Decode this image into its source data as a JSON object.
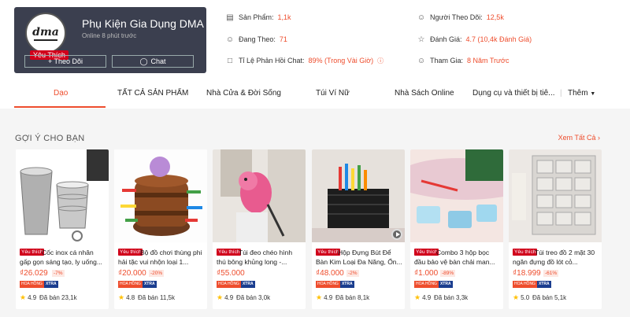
{
  "shop": {
    "name": "Phụ Kiện Gia Dụng DMA",
    "online": "Online 8 phút trước",
    "badge": "Yêu Thích",
    "logo_text": "dma",
    "follow_button": "+ Theo Dõi",
    "chat_button": "Chat"
  },
  "stats": {
    "products_label": "Sản Phẩm:",
    "products_value": "1,1k",
    "following_label": "Đang Theo:",
    "following_value": "71",
    "response_label": "Tỉ Lệ Phản Hồi Chat:",
    "response_value": "89% (Trong Vài Giờ)",
    "followers_label": "Người Theo Dõi:",
    "followers_value": "12,5k",
    "rating_label": "Đánh Giá:",
    "rating_value": "4.7 (10,4k Đánh Giá)",
    "joined_label": "Tham Gia:",
    "joined_value": "8 Năm Trước"
  },
  "tabs": [
    "Dạo",
    "TẤT CẢ SẢN PHẨM",
    "Nhà Cửa & Đời Sống",
    "Túi Ví Nữ",
    "Nhà Sách Online",
    "Dụng cụ và thiết bị tiê...",
    "Thêm"
  ],
  "section": {
    "title": "GỢI Ý CHO BẠN",
    "see_all": "Xem Tất Cả"
  },
  "products": [
    {
      "badge": "Yêu thích",
      "title": "Cốc inox cá nhân gấp gọn sáng tạo, ly uống...",
      "price": "₫26.029",
      "discount": "-7%",
      "tag_a": "HOA HỒNG",
      "tag_b": "XTRA",
      "rating": "4.9",
      "sold": "Đã bán 23,1k"
    },
    {
      "badge": "Yêu thích",
      "title": "Bộ đồ chơi thùng phi hải tặc vui nhộn loại 1...",
      "price": "₫20.000",
      "discount": "-20%",
      "tag_a": "HOA HỒNG",
      "tag_b": "XTRA",
      "rating": "4.8",
      "sold": "Đã bán 11,5k"
    },
    {
      "badge": "Yêu thích",
      "title": "Túi đeo chéo hình thú bông khủng long -...",
      "price": "₫55.000",
      "discount": "",
      "tag_a": "HOA HỒNG",
      "tag_b": "XTRA",
      "rating": "4.9",
      "sold": "Đã bán 3,0k"
    },
    {
      "badge": "Yêu thích",
      "title": "Hộp Đựng Bút Để Bàn Kim Loại Đa Năng, Ổn...",
      "price": "₫48.000",
      "discount": "-2%",
      "tag_a": "HOA HỒNG",
      "tag_b": "XTRA",
      "rating": "4.9",
      "sold": "Đã bán 8,1k"
    },
    {
      "badge": "Yêu thích",
      "title": "Combo 3 hộp bọc đầu bảo vệ bàn chải man...",
      "price": "₫1.000",
      "discount": "-89%",
      "tag_a": "HOA HỒNG",
      "tag_b": "XTRA",
      "rating": "4.9",
      "sold": "Đã bán 3,3k"
    },
    {
      "badge": "Yêu thích",
      "title": "Túi treo đồ 2 mặt 30 ngăn đựng đồ lót cỏ...",
      "price": "₫18.999",
      "discount": "-61%",
      "tag_a": "HOA HỒNG",
      "tag_b": "XTRA",
      "rating": "5.0",
      "sold": "Đã bán 5,1k"
    }
  ],
  "colors": {
    "accent": "#ee4d2d",
    "header_bg": "#3b3f4f",
    "badge_red": "#d0011b"
  }
}
